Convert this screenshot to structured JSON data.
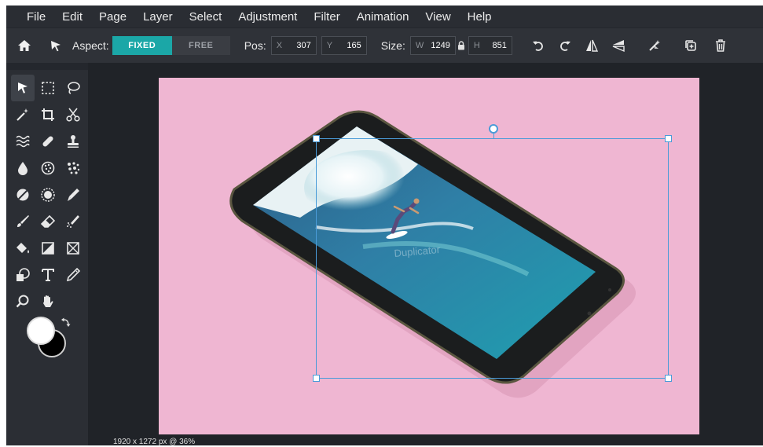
{
  "menu": [
    "File",
    "Edit",
    "Page",
    "Layer",
    "Select",
    "Adjustment",
    "Filter",
    "Animation",
    "View",
    "Help"
  ],
  "toolbar": {
    "aspect_label": "Aspect:",
    "aspect_fixed": "FIXED",
    "aspect_free": "FREE",
    "pos_label": "Pos:",
    "pos_x_axis": "X",
    "pos_x": "307",
    "pos_y_axis": "Y",
    "pos_y": "165",
    "size_label": "Size:",
    "size_w_axis": "W",
    "size_w": "1249",
    "size_h_axis": "H",
    "size_h": "851"
  },
  "icons": {
    "home": "home-icon",
    "select_arrow": "arrow-icon",
    "lock": "lock-icon",
    "undo": "undo-icon",
    "redo": "redo-icon",
    "flip_h": "flip-horizontal-icon",
    "flip_v": "flip-vertical-icon",
    "magic": "magic-icon",
    "duplicate": "duplicate-icon",
    "trash": "trash-icon"
  },
  "tools": [
    "select-tool",
    "marquee-tool",
    "lasso-tool",
    "magic-wand-tool",
    "crop-tool",
    "cut-tool",
    "liquify-tool",
    "healing-tool",
    "stamp-tool",
    "blur-tool",
    "sponge-tool",
    "pixelate-tool",
    "contrast-tool",
    "dodge-tool",
    "smudge-tool",
    "brush-tool",
    "eraser-tool",
    "spray-tool",
    "fill-tool",
    "gradient-tool",
    "frame-tool",
    "shape-tool",
    "text-tool",
    "pen-tool",
    "zoom-tool",
    "hand-tool",
    ""
  ],
  "colors": {
    "accent": "#1ba7a7",
    "foreground": "#ffffff",
    "background": "#000000",
    "canvas_bg": "#efb6d2",
    "selection": "#4a9bd8"
  },
  "canvas": {
    "watermark": "Duplicator"
  },
  "status": {
    "text": "1920 x 1272 px @ 36%"
  }
}
